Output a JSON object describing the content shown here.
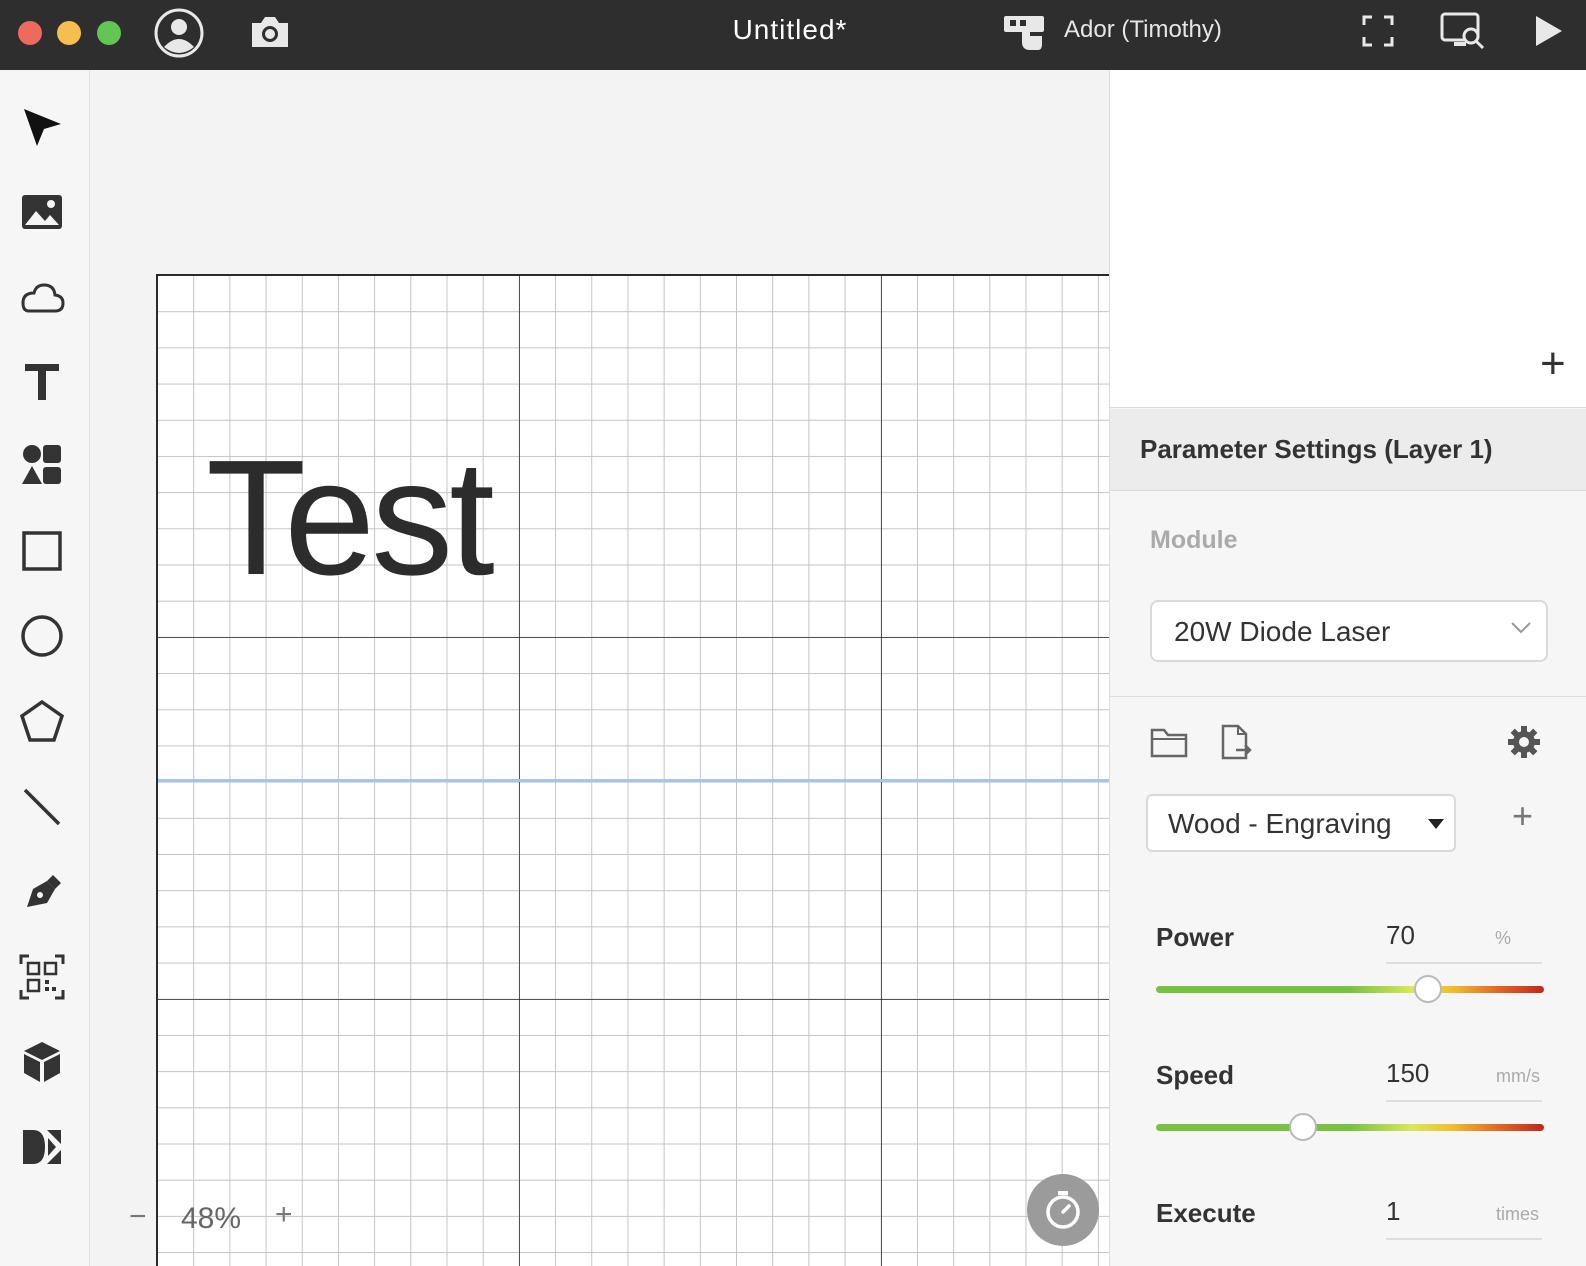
{
  "titlebar": {
    "document_title": "Untitled*",
    "machine_name": "Ador (Timothy)",
    "icons": [
      "profile-icon",
      "camera-icon",
      "machine-icon",
      "frame-icon",
      "preview-icon",
      "play-icon"
    ]
  },
  "toolbar": {
    "tools": [
      "select",
      "image",
      "cloud",
      "text",
      "elements",
      "rectangle",
      "ellipse",
      "polygon",
      "line",
      "pen",
      "qr-code",
      "3d-box",
      "dmkt"
    ]
  },
  "canvas": {
    "text_object": "Test",
    "zoom": {
      "minus": "−",
      "value": "48%",
      "plus": "+"
    }
  },
  "right_panel": {
    "add_layer": "+",
    "title": "Parameter Settings (Layer 1)",
    "module": {
      "label": "Module",
      "value": "20W Diode Laser"
    },
    "preset": {
      "value": "Wood - Engraving",
      "add": "+"
    },
    "params": {
      "power": {
        "label": "Power",
        "value": "70",
        "unit": "%",
        "level_percent": 70
      },
      "speed": {
        "label": "Speed",
        "value": "150",
        "unit": "mm/s",
        "level_fraction": 0.38
      },
      "execute": {
        "label": "Execute",
        "value": "1",
        "unit": "times"
      }
    }
  },
  "colors": {
    "titlebar": "#2e2e2e",
    "close": "#ed6a5e",
    "minimize": "#f5bf4f",
    "zoom": "#62c554",
    "guide_line": "#a9c4ea",
    "slider_start": "#7ac142",
    "slider_end": "#c0281c"
  }
}
